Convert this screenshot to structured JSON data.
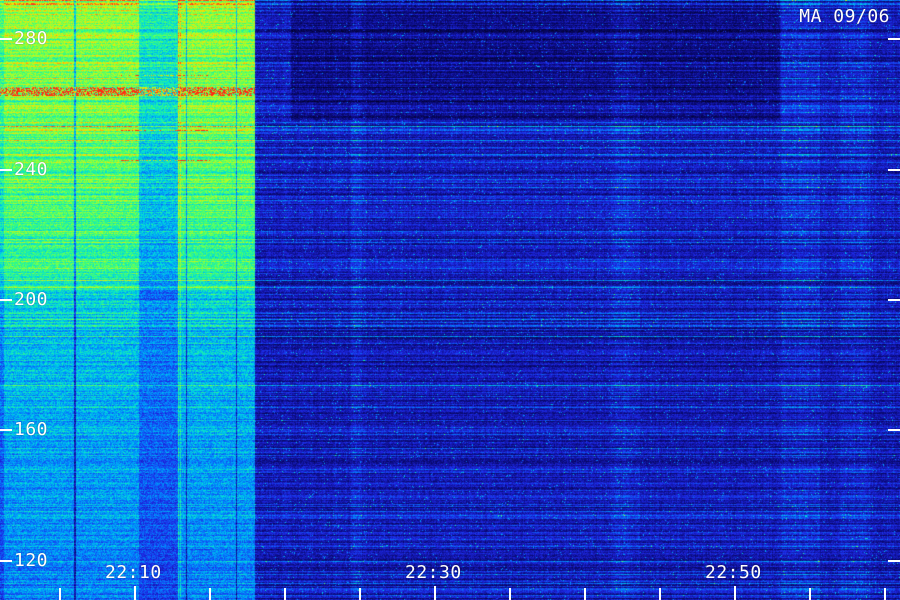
{
  "header": {
    "title": "MA 09/06"
  },
  "y_axis": {
    "tick_labels": [
      "280",
      "240",
      "200",
      "160",
      "120"
    ],
    "tick_values": [
      280,
      240,
      200,
      160,
      120
    ],
    "range": [
      108,
      292
    ]
  },
  "x_axis": {
    "tick_labels": [
      "22:10",
      "22:30",
      "22:50"
    ],
    "tick_minutes": [
      1330,
      1350,
      1370
    ],
    "range_minutes": [
      1321,
      1381
    ],
    "minor_step_minutes": 5
  },
  "colors": {
    "label": "#ffffff",
    "background": "#000000",
    "low": "#00007a",
    "mid": "#00a0ff",
    "high": "#9cff3c",
    "peak": "#ff2020"
  }
}
